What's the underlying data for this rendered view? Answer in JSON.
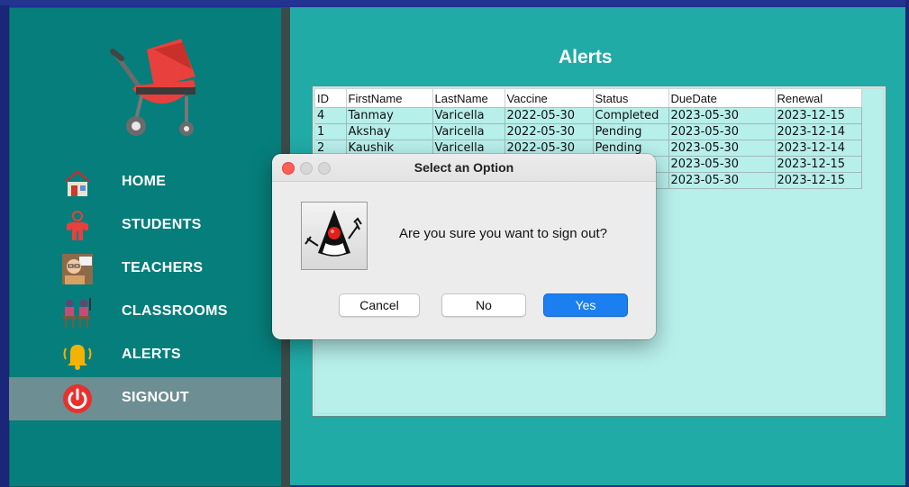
{
  "sidebar": {
    "items": [
      {
        "label": "HOME",
        "icon": "house-icon"
      },
      {
        "label": "STUDENTS",
        "icon": "student-icon"
      },
      {
        "label": "TEACHERS",
        "icon": "teacher-icon"
      },
      {
        "label": "CLASSROOMS",
        "icon": "classroom-icon"
      },
      {
        "label": "ALERTS",
        "icon": "bell-icon"
      },
      {
        "label": "SIGNOUT",
        "icon": "power-icon"
      }
    ],
    "active": "SIGNOUT",
    "logo": "stroller-icon"
  },
  "main": {
    "title": "Alerts",
    "table": {
      "columns": [
        "ID",
        "FirstName",
        "LastName",
        "Vaccine",
        "Status",
        "DueDate",
        "Renewal"
      ],
      "rows": [
        [
          "4",
          "Tanmay",
          "Varicella",
          "2022-05-30",
          "Completed",
          "2023-05-30",
          "2023-12-15"
        ],
        [
          "1",
          "Akshay",
          "Varicella",
          "2022-05-30",
          "Pending",
          "2023-05-30",
          "2023-12-14"
        ],
        [
          "2",
          "Kaushik",
          "Varicella",
          "2022-05-30",
          "Pending",
          "2023-05-30",
          "2023-12-14"
        ],
        [
          "",
          "",
          "",
          "",
          "",
          "2023-05-30",
          "2023-12-15"
        ],
        [
          "",
          "",
          "",
          "",
          "",
          "2023-05-30",
          "2023-12-15"
        ]
      ]
    }
  },
  "dialog": {
    "title": "Select an Option",
    "message": "Are you sure you want to sign out?",
    "icon": "java-duke-icon",
    "buttons": {
      "cancel": "Cancel",
      "no": "No",
      "yes": "Yes"
    }
  },
  "colors": {
    "sidebar_bg": "#067e7b",
    "main_bg": "#20aba6",
    "active_item_bg": "#6d8e93",
    "table_bg": "#b7efeb",
    "primary_button": "#1b7ff0"
  }
}
